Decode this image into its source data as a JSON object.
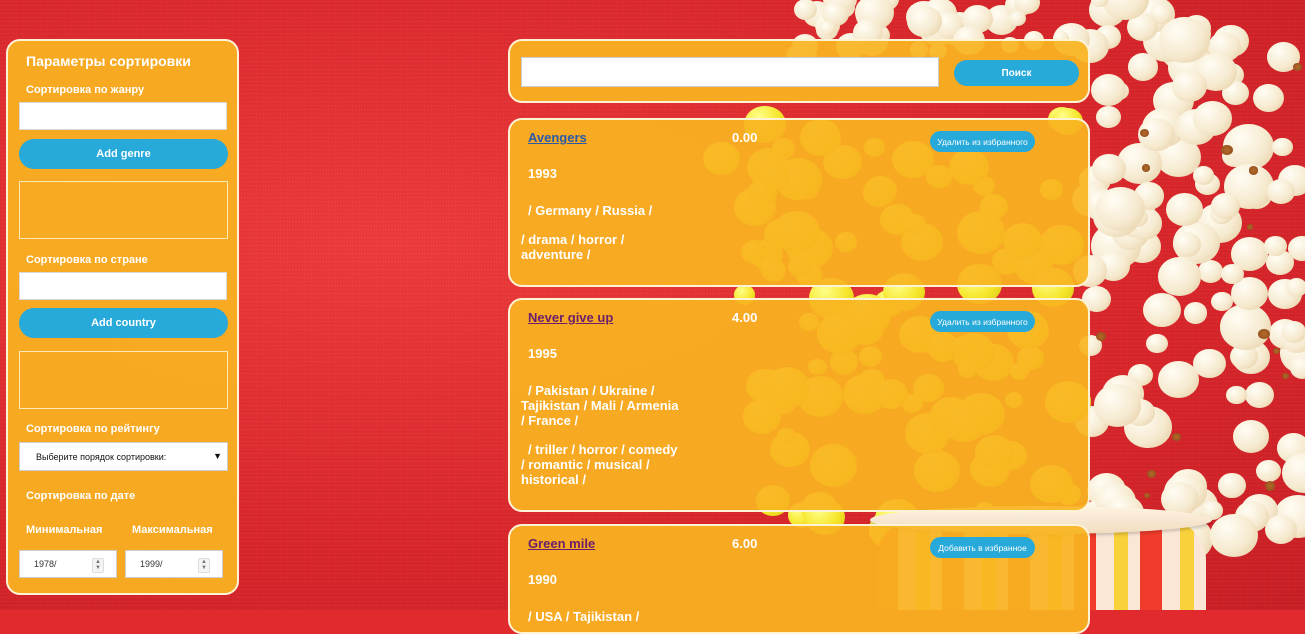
{
  "sidebar": {
    "title": "Параметры сортировки",
    "genre_label": "Сортировка по жанру",
    "genre_input_value": "",
    "add_genre_label": "Add genre",
    "country_label": "Сортировка по стране",
    "country_input_value": "",
    "add_country_label": "Add country",
    "rating_label": "Сортировка по рейтингу",
    "rating_select_value": "Выберите порядок сортировки:",
    "date_label": "Сортировка по дате",
    "min_label": "Минимальная",
    "max_label": "Максимальная",
    "min_value": "1978/",
    "max_value": "1999/"
  },
  "search": {
    "input_value": "",
    "button_label": "Поиск"
  },
  "movies": [
    {
      "title": "Avengers",
      "rating": "0.00",
      "fav_label": "Удалить из избранного",
      "year": "1993",
      "countries": "/ Germany / Russia /",
      "genres": "/ drama / horror / adventure /"
    },
    {
      "title": "Never give up",
      "rating": "4.00",
      "fav_label": "Удалить из избранного",
      "year": "1995",
      "countries": "/ Pakistan / Ukraine / Tajikistan / Mali / Armenia / France /",
      "genres": "/ triller / horror / comedy / romantic / musical / historical /"
    },
    {
      "title": "Green mile",
      "rating": "6.00",
      "fav_label": "Добавить в избранное",
      "year": "1990",
      "countries": "/ USA / Tajikistan /",
      "genres": ""
    }
  ],
  "colors": {
    "panel": "#f9b421",
    "button": "#27a9d9",
    "background": "#e02a2e"
  },
  "icons": {
    "select": "chevron-down-icon",
    "spinner": "spinner-arrows-icon"
  }
}
